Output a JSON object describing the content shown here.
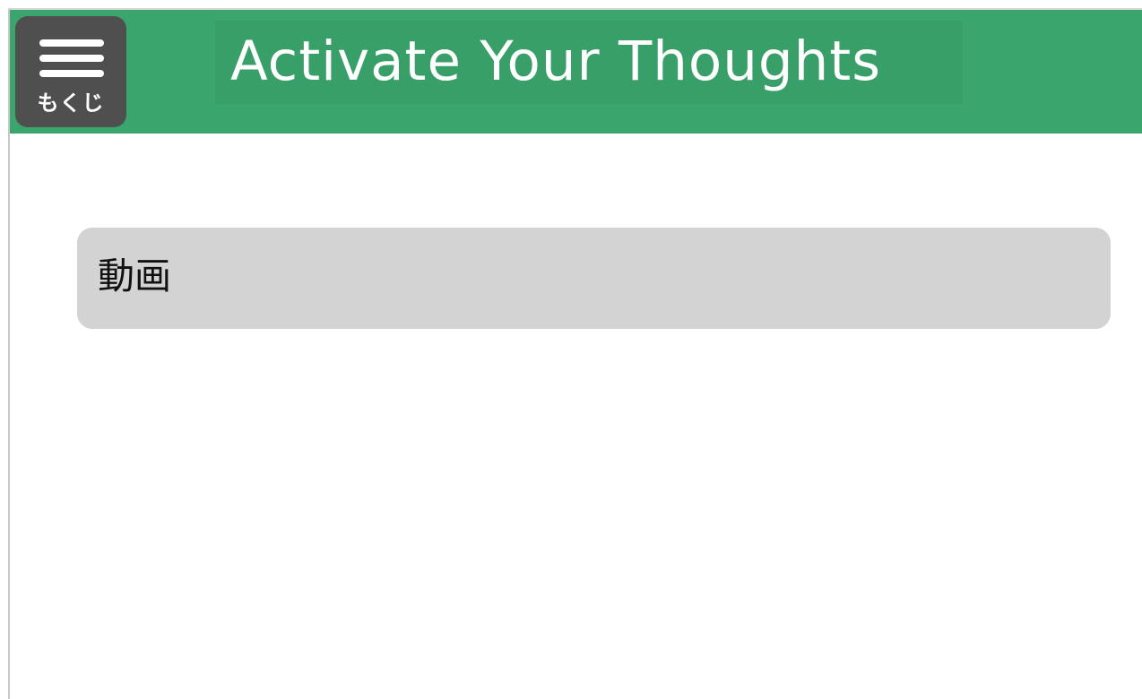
{
  "header": {
    "menu_icon": "hamburger-menu-icon",
    "menu_label": "もくじ",
    "title": "Activate Your Thoughts"
  },
  "main": {
    "section_label": "動画"
  },
  "colors": {
    "header_bg": "#3aa56c",
    "title_bg": "#389f68",
    "menu_bg": "#4f4f4f",
    "section_bg": "#d3d3d3"
  }
}
